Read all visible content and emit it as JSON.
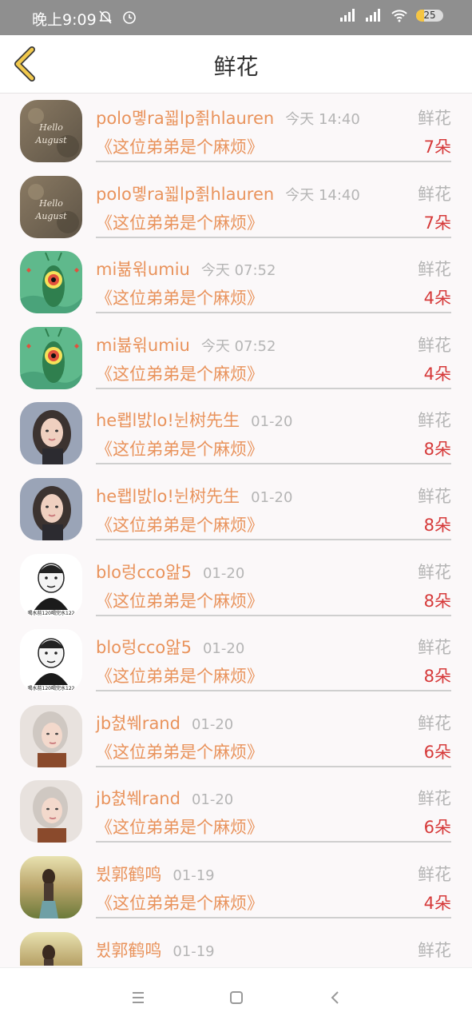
{
  "status_bar": {
    "time": "晚上9:09",
    "battery": "25"
  },
  "header": {
    "title": "鲜花"
  },
  "rows": [
    {
      "name": "polo몧ra꾋lp죍hlauren",
      "time": "今天 14:40",
      "tag": "鲜花",
      "book": "《这位弟弟是个麻烦》",
      "count": "7朵",
      "avatar": "avatar-photo-hello-august"
    },
    {
      "name": "polo몧ra꾋lp죍hlauren",
      "time": "今天 14:40",
      "tag": "鲜花",
      "book": "《这位弟弟是个麻烦》",
      "count": "7朵",
      "avatar": "avatar-photo-hello-august"
    },
    {
      "name": "mi뷺윆umiu",
      "time": "今天 07:52",
      "tag": "鲜花",
      "book": "《这位弟弟是个麻烦》",
      "count": "4朵",
      "avatar": "avatar-plankton"
    },
    {
      "name": "mi뷺윆umiu",
      "time": "今天 07:52",
      "tag": "鲜花",
      "book": "《这位弟弟是个麻烦》",
      "count": "4朵",
      "avatar": "avatar-plankton"
    },
    {
      "name": "he뢥l밠lo!뉜树先生",
      "time": "01-20",
      "tag": "鲜花",
      "book": "《这位弟弟是个麻烦》",
      "count": "8朵",
      "avatar": "avatar-girl-portrait"
    },
    {
      "name": "he뢥l밠lo!뉜树先生",
      "time": "01-20",
      "tag": "鲜花",
      "book": "《这位弟弟是个麻烦》",
      "count": "8朵",
      "avatar": "avatar-girl-portrait"
    },
    {
      "name": "blo렁cco앒5",
      "time": "01-20",
      "tag": "鲜花",
      "book": "《这位弟弟是个麻烦》",
      "count": "8朵",
      "avatar": "avatar-cartoon-man"
    },
    {
      "name": "blo렁cco앒5",
      "time": "01-20",
      "tag": "鲜花",
      "book": "《这位弟弟是个麻烦》",
      "count": "8朵",
      "avatar": "avatar-cartoon-man"
    },
    {
      "name": "jb쳜쒜rand",
      "time": "01-20",
      "tag": "鲜花",
      "book": "《这位弟弟是个麻烦》",
      "count": "6朵",
      "avatar": "avatar-blonde-girl"
    },
    {
      "name": "jb쳜쒜rand",
      "time": "01-20",
      "tag": "鲜花",
      "book": "《这位弟弟是个麻烦》",
      "count": "6朵",
      "avatar": "avatar-blonde-girl"
    },
    {
      "name": "뷨郭鹤鸣",
      "time": "01-19",
      "tag": "鲜花",
      "book": "《这位弟弟是个麻烦》",
      "count": "4朵",
      "avatar": "avatar-field-girl"
    },
    {
      "name": "뷨郭鹤鸣",
      "time": "01-19",
      "tag": "鲜花",
      "book": "",
      "count": "",
      "avatar": "avatar-field-girl"
    }
  ],
  "avatar_text": {
    "hello_august": "Hello August",
    "cartoon_caption": "喝水前120喝完水122"
  },
  "colors": {
    "name": "#e9935c",
    "count": "#d63a3a",
    "muted": "#b5b5b5",
    "back_arrow": "#f2c94c"
  }
}
